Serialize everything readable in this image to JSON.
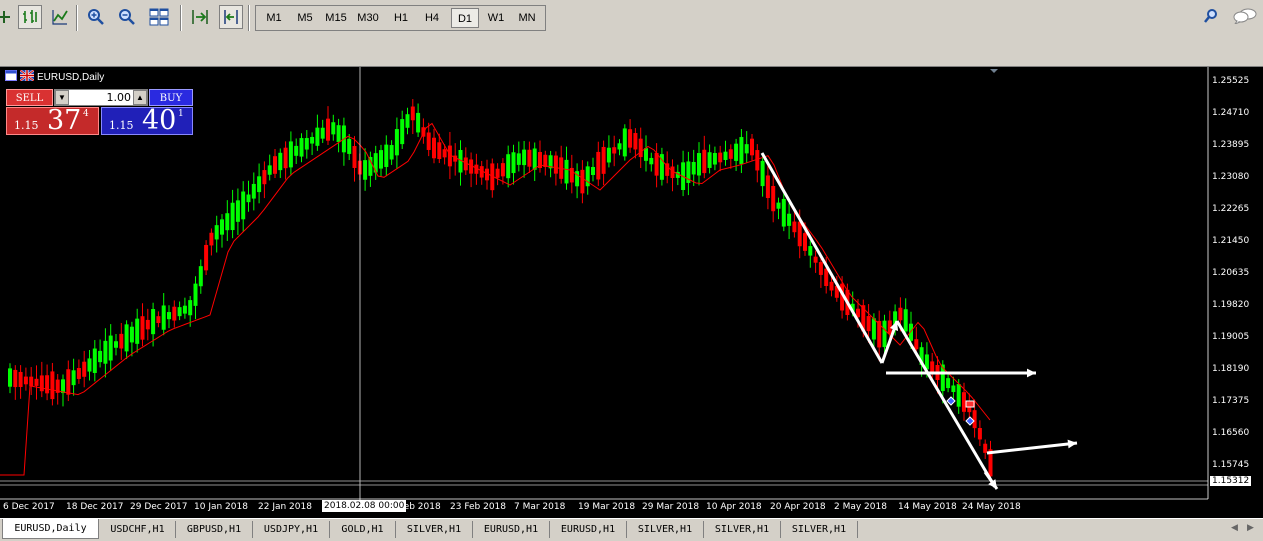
{
  "toolbar": {
    "timeframes": [
      "M1",
      "M5",
      "M15",
      "M30",
      "H1",
      "H4",
      "D1",
      "W1",
      "MN"
    ],
    "active_timeframe": "D1",
    "icons": [
      "line-chart-icon",
      "bar-chart-icon",
      "candlestick-chart-icon",
      "zoom-in-icon",
      "zoom-out-icon",
      "tile-windows-icon",
      "auto-scroll-icon",
      "chart-shift-icon",
      "search-icon",
      "chat-icon"
    ]
  },
  "chart": {
    "title": "EURUSD,Daily",
    "crosshair_date": "2018.02.08 00:00",
    "current_price": "1.15312",
    "price_labels": [
      "1.25525",
      "1.24710",
      "1.23895",
      "1.23080",
      "1.22265",
      "1.21450",
      "1.20635",
      "1.19820",
      "1.19005",
      "1.18190",
      "1.17375",
      "1.16560",
      "1.15745"
    ],
    "date_labels": [
      "6 Dec 2017",
      "18 Dec 2017",
      "29 Dec 2017",
      "10 Jan 2018",
      "22 Jan 2018",
      "Feb 2018",
      "23 Feb 2018",
      "7 Mar 2018",
      "19 Mar 2018",
      "29 Mar 2018",
      "10 Apr 2018",
      "20 Apr 2018",
      "2 May 2018",
      "14 May 2018",
      "24 May 2018"
    ],
    "colors": {
      "background": "#000000",
      "bull": "#00ff00",
      "bear": "#ff0000",
      "ma": "#ff0000",
      "arrows": "#ffffff"
    }
  },
  "trade_panel": {
    "sell_label": "SELL",
    "buy_label": "BUY",
    "lot": "1.00",
    "sell_prefix": "1.15",
    "sell_big": "37",
    "sell_sup": "4",
    "buy_prefix": "1.15",
    "buy_big": "40",
    "buy_sup": "1"
  },
  "tabs": [
    "EURUSD,Daily",
    "USDCHF,H1",
    "GBPUSD,H1",
    "USDJPY,H1",
    "GOLD,H1",
    "SILVER,H1",
    "EURUSD,H1",
    "EURUSD,H1",
    "SILVER,H1",
    "SILVER,H1",
    "SILVER,H1"
  ],
  "active_tab": "EURUSD,Daily"
}
